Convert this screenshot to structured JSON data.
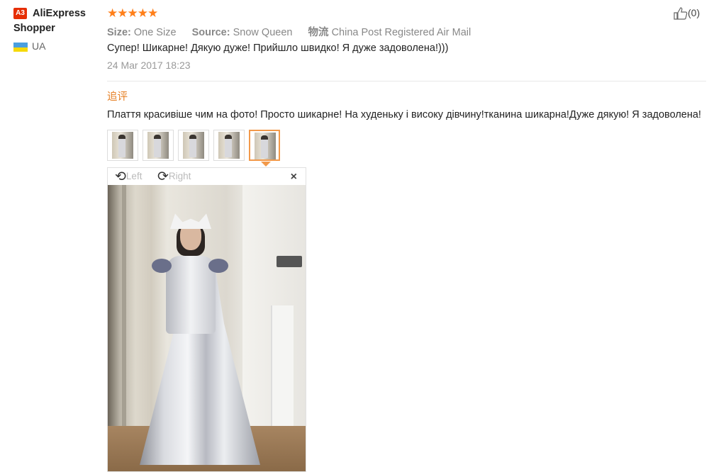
{
  "user": {
    "badge": "A3",
    "name": "AliExpress Shopper",
    "country": "UA",
    "flag_colors": [
      "#4a9fe0",
      "#f5d90a"
    ]
  },
  "review": {
    "stars": "★★★★★",
    "rating": 5,
    "size_label": "Size:",
    "size_value": "One Size",
    "source_label": "Source:",
    "source_value": "Snow Queen",
    "shipping_label": "物流",
    "shipping_value": "China Post Registered Air Mail",
    "text": "Супер! Шикарне! Дякую дуже! Прийшло швидко! Я дуже задоволена!)))",
    "date": "24 Mar 2017 18:23",
    "helpful_count": "(0)"
  },
  "additional": {
    "title": "追评",
    "text": "Плаття красивіше чим на фото! Просто шикарне! На худеньку і високу дівчину!тканина шикарна!Дуже дякую! Я задоволена!"
  },
  "viewer": {
    "rotate_left_label": "Left",
    "rotate_right_label": "Right",
    "close_label": "×",
    "selected_thumbnail": 5,
    "thumbnail_count": 5
  },
  "colors": {
    "accent": "#e67e22",
    "star": "#ff7f1a",
    "selected_border": "#f2994a",
    "badge": "#e62e04"
  }
}
